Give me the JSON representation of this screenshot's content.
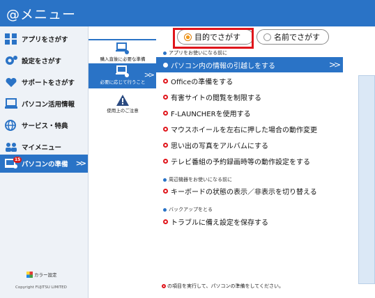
{
  "app": {
    "title": "@メニュー"
  },
  "sidebar": {
    "items": [
      {
        "label": "アプリをさがす",
        "icon": "apps-icon"
      },
      {
        "label": "設定をさがす",
        "icon": "gear-icon"
      },
      {
        "label": "サポートをさがす",
        "icon": "heart-hand-icon"
      },
      {
        "label": "パソコン活用情報",
        "icon": "laptop-icon"
      },
      {
        "label": "サービス・特典",
        "icon": "globe-icon"
      },
      {
        "label": "マイメニュー",
        "icon": "people-icon"
      },
      {
        "label": "パソコンの準備",
        "icon": "pc-setup-icon",
        "badge": "15"
      }
    ],
    "color_setting": "カラー設定",
    "copyright": "Copyright FUJITSU LIMITED"
  },
  "midcol": {
    "items": [
      {
        "label": "購入直後に必要な準備"
      },
      {
        "label": "必要に応じて行うこと"
      },
      {
        "label": "使用上のご注意"
      }
    ]
  },
  "main": {
    "tabs": [
      {
        "label": "目的でさがす"
      },
      {
        "label": "名前でさがす"
      }
    ],
    "sections": [
      {
        "heading": "アプリをお使いになる前に",
        "items": [
          "パソコン内の情報の引越しをする",
          "Officeの準備をする",
          "有害サイトの閲覧を制限する",
          "F-LAUNCHERを使用する",
          "マウスホイールを左右に押した場合の動作変更",
          "思い出の写真をアルバムにする",
          "テレビ番組の予約録画時等の動作設定をする"
        ]
      },
      {
        "heading": "周辺機器をお使いになる前に",
        "items": [
          "キーボードの状態の表示／非表示を切り替える"
        ]
      },
      {
        "heading": "バックアップをとる",
        "items": [
          "トラブルに備え設定を保存する"
        ]
      }
    ],
    "footer_note": "の項目を実行して、パソコンの準備をしてください。"
  },
  "colors": {
    "accent": "#2a73c6",
    "highlight_red": "#e0151b",
    "selected_radio": "#f39a1a"
  }
}
